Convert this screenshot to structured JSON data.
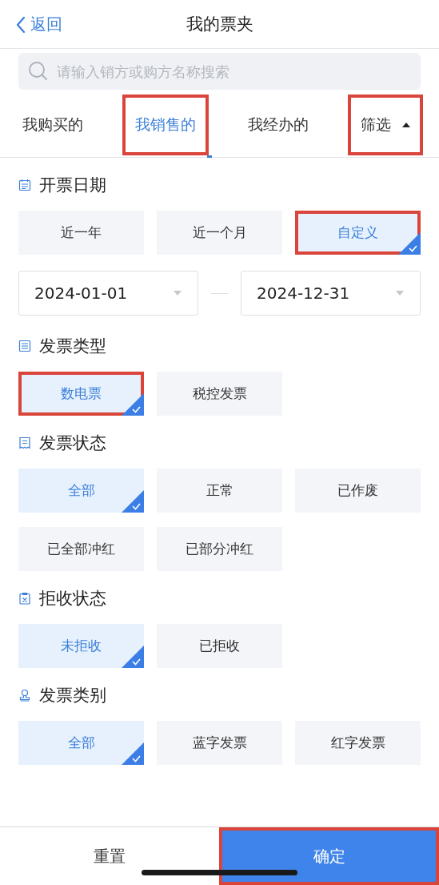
{
  "nav": {
    "back": "返回",
    "title": "我的票夹"
  },
  "search": {
    "placeholder": "请输入销方或购方名称搜索"
  },
  "tabs": [
    {
      "kind": "tab",
      "label": "我购买的",
      "selected": false,
      "highlighted": false
    },
    {
      "kind": "tab",
      "label": "我销售的",
      "selected": true,
      "highlighted": true
    },
    {
      "kind": "tab",
      "label": "我经办的",
      "selected": false,
      "highlighted": false
    },
    {
      "kind": "filter",
      "label": "筛选",
      "expanded": true,
      "highlighted": true
    }
  ],
  "sections": [
    {
      "title": "开票日期",
      "options": [
        {
          "label": "近一年",
          "selected": false,
          "highlighted": false
        },
        {
          "label": "近一个月",
          "selected": false,
          "highlighted": false
        },
        {
          "label": "自定义",
          "selected": true,
          "highlighted": true
        }
      ],
      "date_range": {
        "start": "2024-01-01",
        "end": "2024-12-31"
      }
    },
    {
      "title": "发票类型",
      "options": [
        {
          "label": "数电票",
          "selected": true,
          "highlighted": true
        },
        {
          "label": "税控发票",
          "selected": false,
          "highlighted": false
        }
      ]
    },
    {
      "title": "发票状态",
      "options": [
        {
          "label": "全部",
          "selected": true,
          "highlighted": false
        },
        {
          "label": "正常",
          "selected": false,
          "highlighted": false
        },
        {
          "label": "已作废",
          "selected": false,
          "highlighted": false
        },
        {
          "label": "已全部冲红",
          "selected": false,
          "highlighted": false
        },
        {
          "label": "已部分冲红",
          "selected": false,
          "highlighted": false
        }
      ]
    },
    {
      "title": "拒收状态",
      "options": [
        {
          "label": "未拒收",
          "selected": true,
          "highlighted": false
        },
        {
          "label": "已拒收",
          "selected": false,
          "highlighted": false
        }
      ]
    },
    {
      "title": "发票类别",
      "options": [
        {
          "label": "全部",
          "selected": true,
          "highlighted": false
        },
        {
          "label": "蓝字发票",
          "selected": false,
          "highlighted": false
        },
        {
          "label": "红字发票",
          "selected": false,
          "highlighted": false
        }
      ]
    }
  ],
  "footer": {
    "reset": "重置",
    "confirm": "确定",
    "confirm_highlighted": true
  }
}
